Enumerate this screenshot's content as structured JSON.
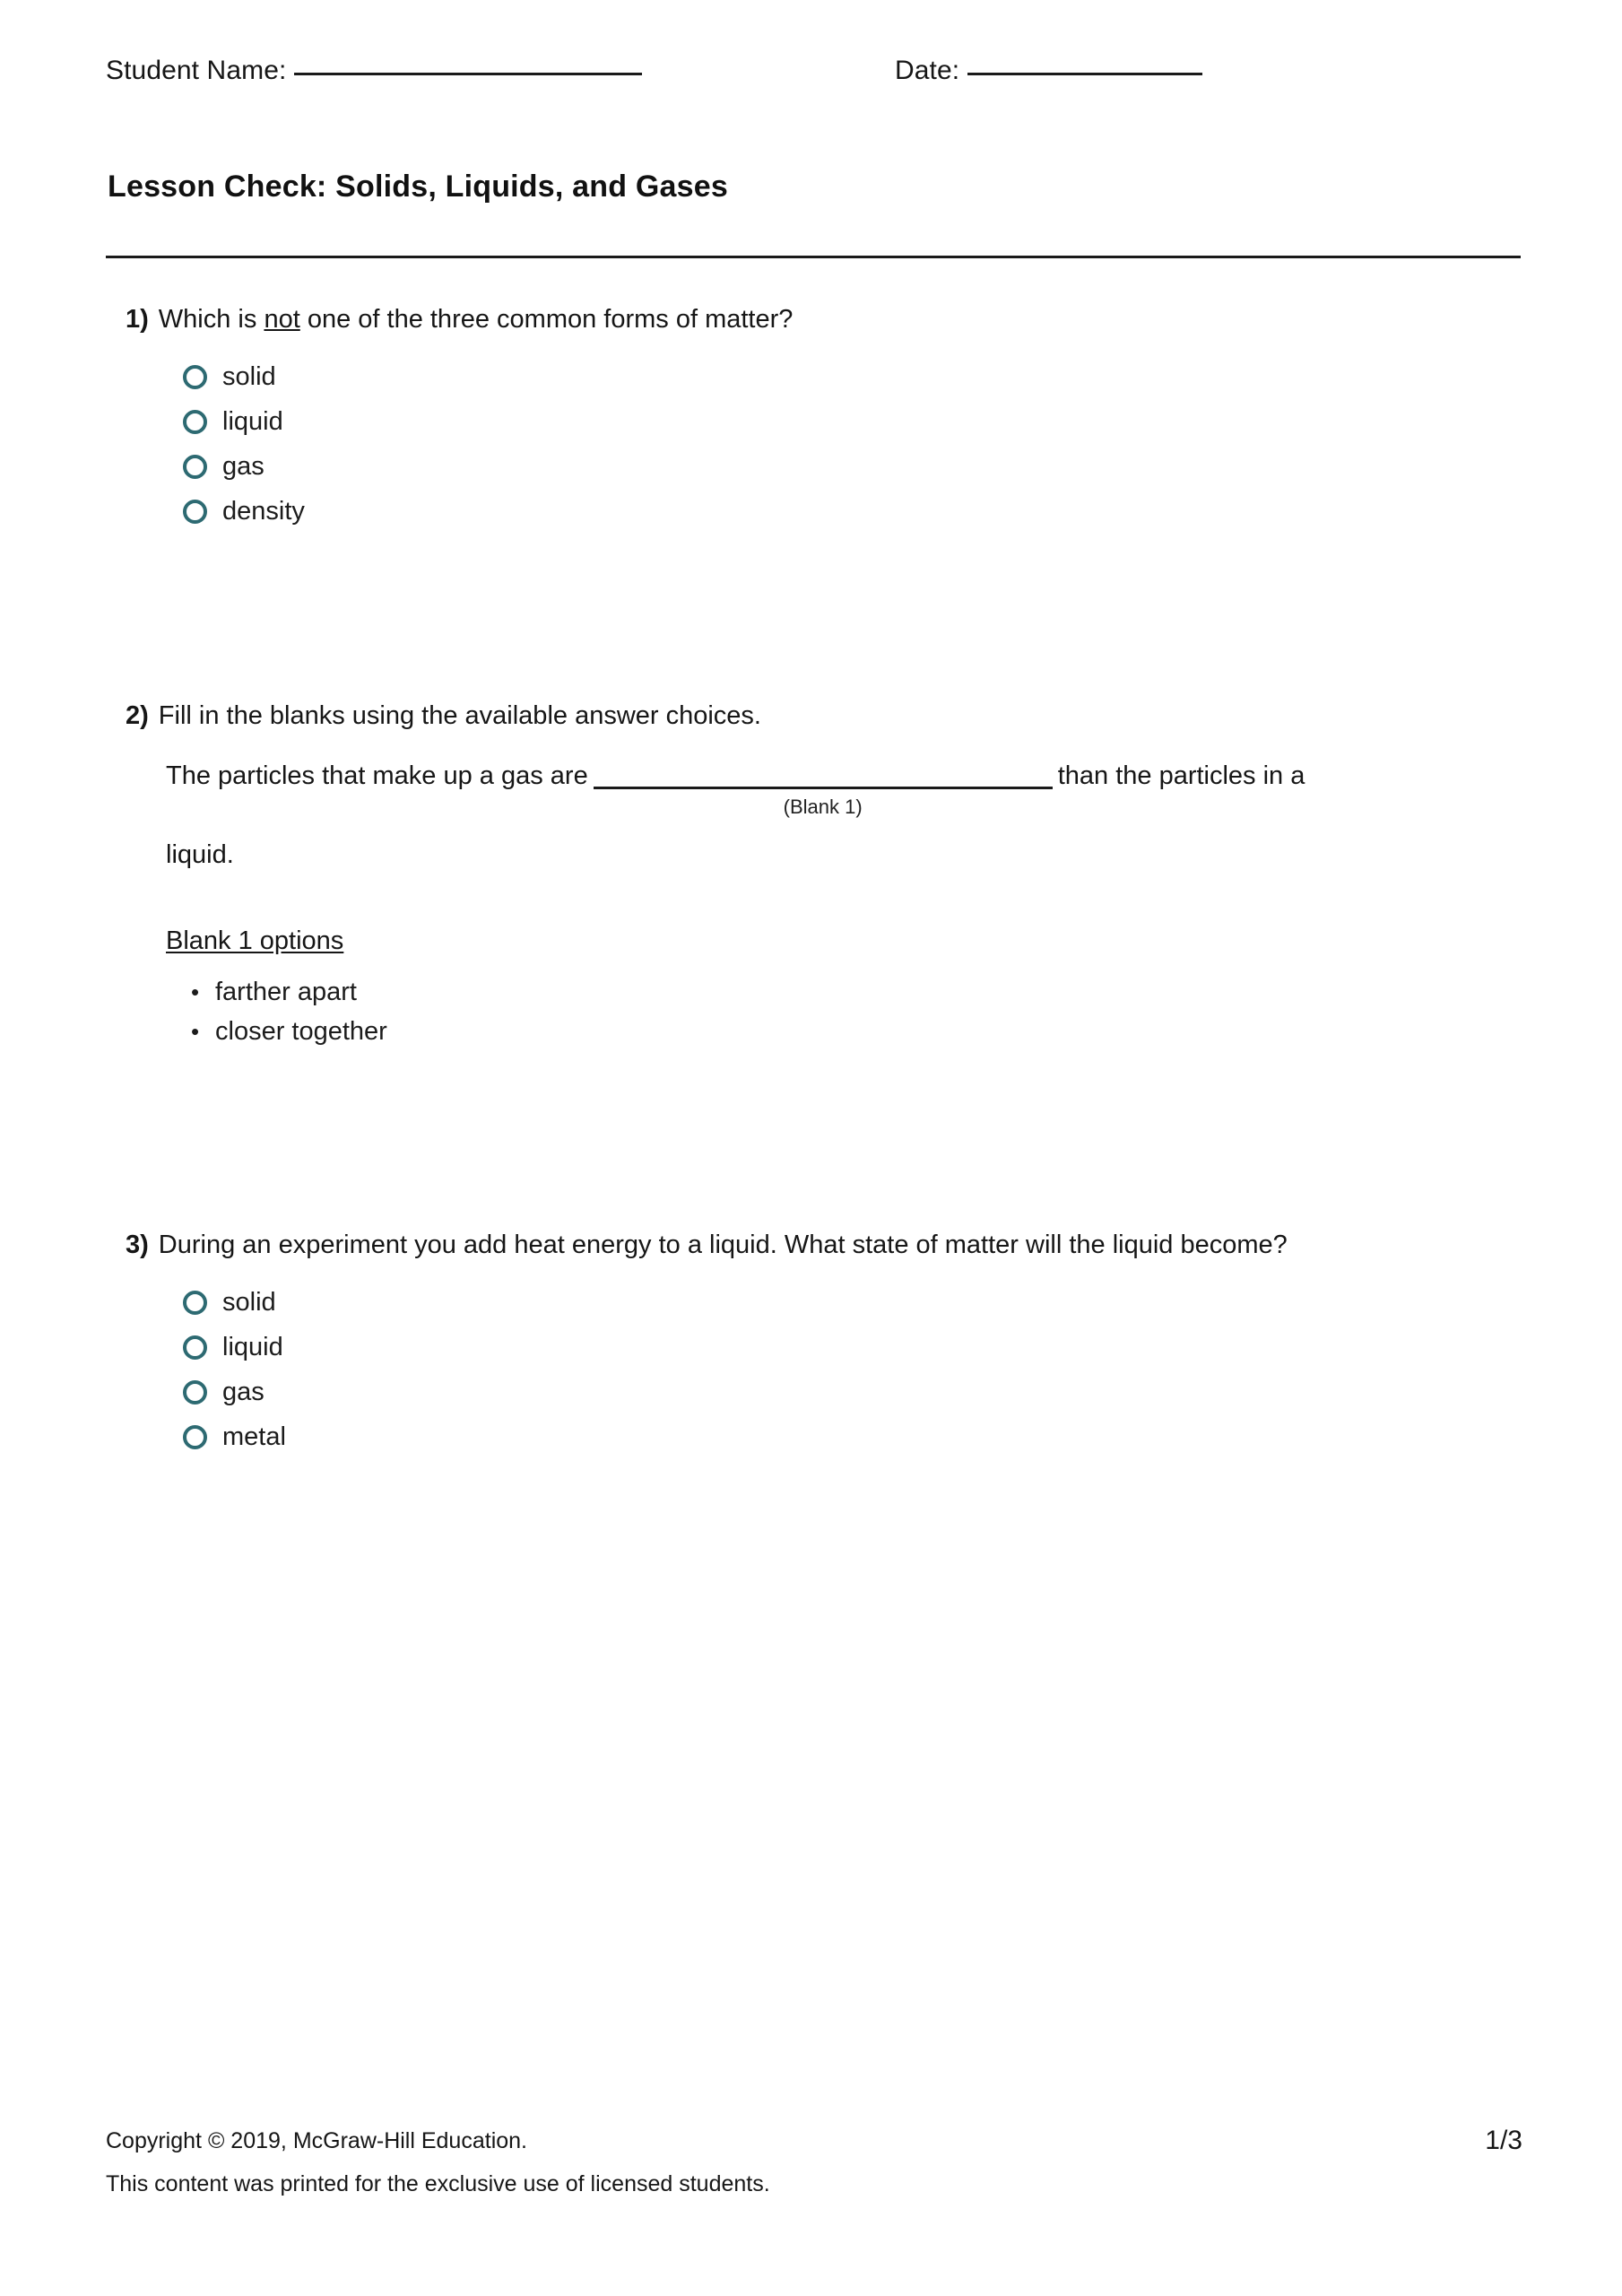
{
  "header": {
    "student_name_label": "Student Name:",
    "date_label": "Date:"
  },
  "title": "Lesson Check: Solids, Liquids, and Gases",
  "questions": [
    {
      "number": "1)",
      "type": "multiple-choice",
      "prompt_before": "Which is ",
      "prompt_underlined": "not",
      "prompt_after": " one of the three common forms of matter?",
      "choices": [
        "solid",
        "liquid",
        "gas",
        "density"
      ]
    },
    {
      "number": "2)",
      "type": "fill-in-the-blank",
      "prompt": "Fill in the blanks using the available answer choices.",
      "sentence_start": "The particles that make up a gas are",
      "blank_label": "(Blank 1)",
      "sentence_middle": "than the particles in a",
      "sentence_end": "liquid.",
      "options_title": "Blank 1 options",
      "options": [
        "farther apart",
        "closer together"
      ]
    },
    {
      "number": "3)",
      "type": "multiple-choice",
      "prompt": "During an experiment you add heat energy to a liquid. What state of matter will the liquid become?",
      "choices": [
        "solid",
        "liquid",
        "gas",
        "metal"
      ]
    }
  ],
  "footer": {
    "copyright": "Copyright © 2019, McGraw-Hill Education.",
    "notice": "This content was printed for the exclusive use of licensed students.",
    "page_number": "1/3"
  },
  "colors": {
    "radio_outline": "#2d6a72",
    "text": "#161616",
    "rule": "#1a1a1a"
  }
}
